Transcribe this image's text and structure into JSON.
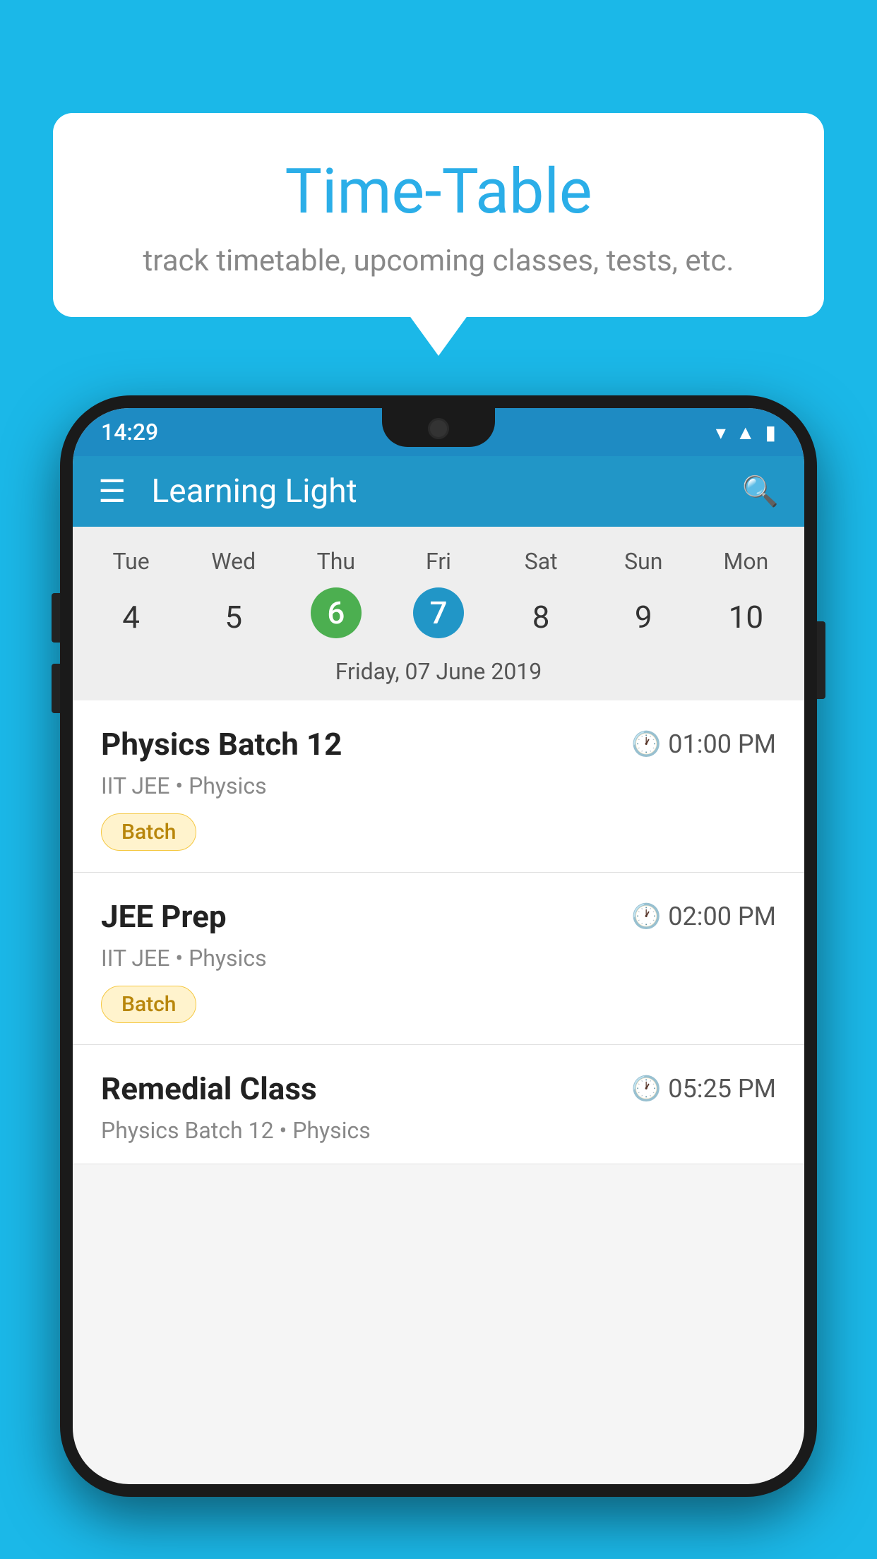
{
  "background": {
    "color": "#1bb8e8"
  },
  "speech_bubble": {
    "title": "Time-Table",
    "subtitle": "track timetable, upcoming classes, tests, etc."
  },
  "phone": {
    "status_bar": {
      "time": "14:29"
    },
    "app_bar": {
      "title": "Learning Light"
    },
    "calendar": {
      "days": [
        "Tue",
        "Wed",
        "Thu",
        "Fri",
        "Sat",
        "Sun",
        "Mon"
      ],
      "dates": [
        "4",
        "5",
        "6",
        "7",
        "8",
        "9",
        "10"
      ],
      "today_index": 2,
      "selected_index": 3,
      "selected_date_label": "Friday, 07 June 2019"
    },
    "schedule": [
      {
        "title": "Physics Batch 12",
        "time": "01:00 PM",
        "subtitle": "IIT JEE • Physics",
        "tag": "Batch"
      },
      {
        "title": "JEE Prep",
        "time": "02:00 PM",
        "subtitle": "IIT JEE • Physics",
        "tag": "Batch"
      },
      {
        "title": "Remedial Class",
        "time": "05:25 PM",
        "subtitle": "Physics Batch 12 • Physics",
        "tag": null
      }
    ]
  }
}
